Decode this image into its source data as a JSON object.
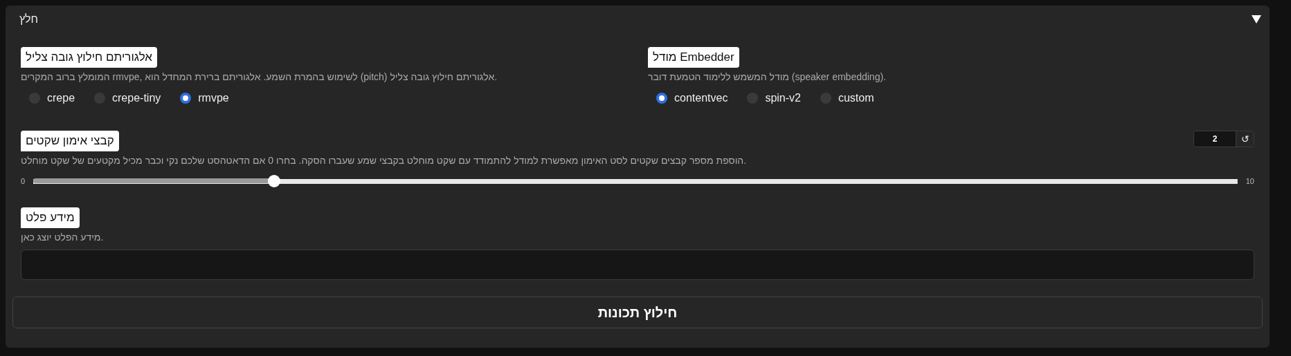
{
  "panel": {
    "title": "חלץ",
    "expanded": true
  },
  "groups": [
    {
      "label": "מודל Embedder",
      "description": "מודל המשמש ללימוד הטמעת דובר (speaker embedding).",
      "options": [
        {
          "label": "custom",
          "selected": false
        },
        {
          "label": "spin-v2",
          "selected": false
        },
        {
          "label": "contentvec",
          "selected": true
        }
      ]
    },
    {
      "label": "אלגוריתם חילוץ גובה צליל",
      "description": "המומלץ ברוב המקרים rmvpe, לשימוש בהמרת השמע. אלגוריתם ברירת המחדל הוא (pitch) אלגוריתם חילוץ גובה צליל.",
      "options": [
        {
          "label": "rmvpe",
          "selected": true
        },
        {
          "label": "crepe-tiny",
          "selected": false
        },
        {
          "label": "crepe",
          "selected": false
        }
      ]
    }
  ],
  "slider": {
    "label": "קבצי אימון שקטים",
    "description": "הוספת מספר קבצים שקטים לסט האימון מאפשרת למודל להתמודד עם שקט מוחלט בקבצי שמע שעברו הסקה. בחרו 0 אם הדאטהסט שלכם נקי וכבר מכיל מקטעים של שקט מוחלט.",
    "value": "2",
    "reset_label": "↺",
    "min_label": "0",
    "max_label": "10",
    "level": 0.2
  },
  "info": {
    "label": "מידע פלט",
    "description": "מידע הפלט יוצג כאן."
  },
  "button": {
    "label": "חילוץ תכונות"
  }
}
